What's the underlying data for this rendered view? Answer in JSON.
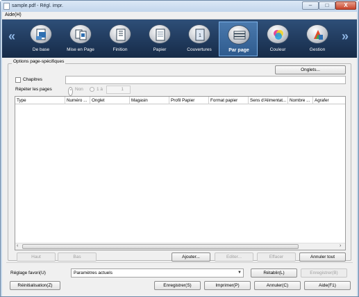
{
  "window": {
    "title": "sample.pdf - Régl. impr.",
    "min": "–",
    "max": "□",
    "close": "X"
  },
  "menu": {
    "help": "Aide(H)"
  },
  "toolbar": {
    "prev": "«",
    "next": "»",
    "items": [
      {
        "label": "De base",
        "icon": "basic-settings-icon"
      },
      {
        "label": "Mise en Page",
        "icon": "layout-icon"
      },
      {
        "label": "Finition",
        "icon": "finishing-icon"
      },
      {
        "label": "Papier",
        "icon": "paper-icon"
      },
      {
        "label": "Couvertures",
        "icon": "cover-icon"
      },
      {
        "label": "Par page",
        "icon": "per-page-icon",
        "active": true
      },
      {
        "label": "Couleur",
        "icon": "color-icon"
      },
      {
        "label": "Gestion",
        "icon": "management-icon"
      }
    ]
  },
  "options": {
    "legend": "Options page-spécifiques",
    "tabs_button": "Onglets...",
    "chapters_label": "Chapitres",
    "chapters_value": "",
    "repeat_label": "Répéter les pages",
    "radio_no": "Non",
    "radio_one_to": "1 à",
    "repeat_value": "1",
    "columns": [
      "Type",
      "Numéro ...",
      "Onglet",
      "Magasin",
      "Profil Papier",
      "Format papier",
      "Sens d'Alimentat...",
      "Nombre ...",
      "Agrafer"
    ],
    "scroll_left": "‹",
    "scroll_right": "›",
    "buttons": {
      "up": "Haut",
      "down": "Bas",
      "add": "Ajouter...",
      "edit": "Editer...",
      "delete": "Effacer",
      "undo_all": "Annuler tout"
    }
  },
  "footer": {
    "favorite_label": "Réglage favori(U)",
    "favorite_value": "Paramètres actuels",
    "restore": "Rétablir(L)",
    "save_fav": "Enregistrer(B)",
    "reset": "Réinitialisation(Z)",
    "save": "Enregistrer(S)",
    "print": "Imprimer(P)",
    "cancel": "Annuler(C)",
    "help": "Aide(F1)"
  }
}
